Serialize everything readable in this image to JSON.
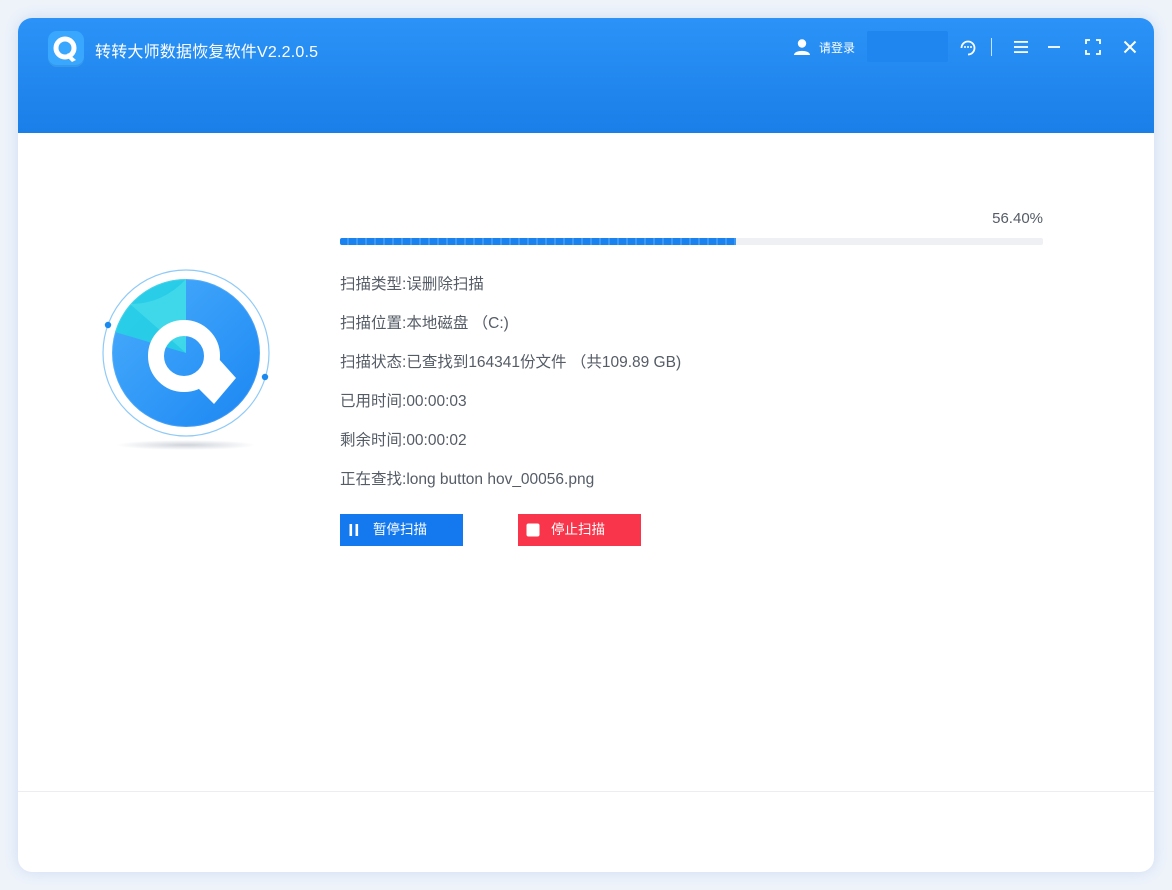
{
  "window": {
    "title": "转转大师数据恢复软件V2.2.0.5",
    "login_label": "请登录",
    "icons": [
      "app-logo-icon",
      "user-icon",
      "support-icon",
      "menu-icon",
      "minimize-icon",
      "maximize-icon",
      "close-icon"
    ]
  },
  "progress": {
    "percent_label": "56.40%",
    "value": 56.4
  },
  "scan_info": {
    "type_label": "扫描类型:",
    "type_value": "误删除扫描",
    "location_label": "扫描位置:",
    "location_value": "本地磁盘 （C:)",
    "status_label": "扫描状态:",
    "status_value": "已查找到164341份文件 （共109.89 GB)",
    "elapsed_label": "已用时间:",
    "elapsed_value": "00:00:03",
    "remaining_label": "剩余时间:",
    "remaining_value": "00:00:02",
    "current_label": "正在查找:",
    "current_value": "long button hov_00056.png"
  },
  "buttons": {
    "pause_label": "暂停扫描",
    "stop_label": "停止扫描"
  },
  "colors": {
    "titlebar": "#1a7fe8",
    "accent": "#1478ee",
    "stop": "#f8354a",
    "text": "#555c66"
  }
}
